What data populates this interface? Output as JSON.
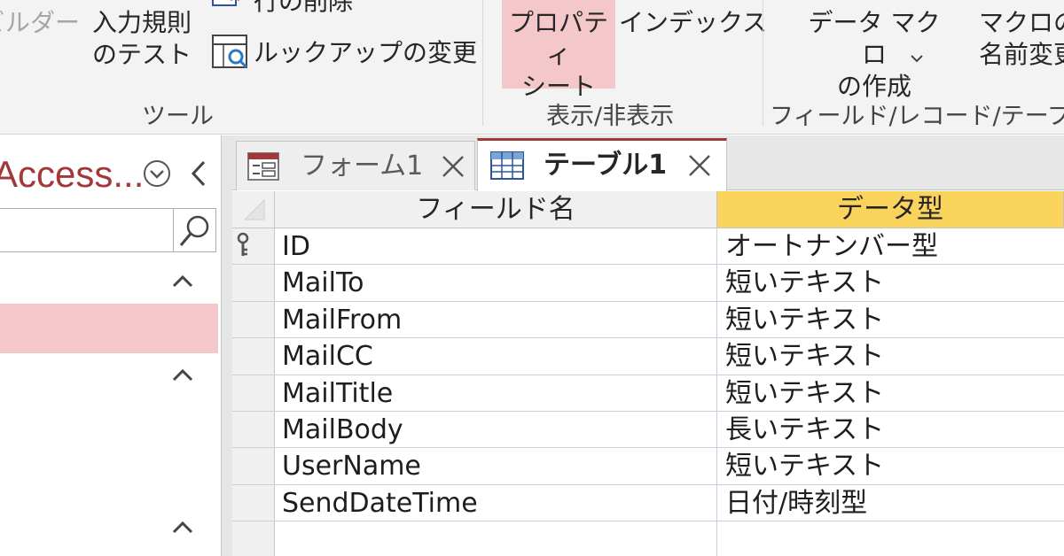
{
  "ribbon": {
    "tools_group": {
      "label": "ツール",
      "builder_label": "ビルダー",
      "test_rules_label": "入力規則\nのテスト",
      "delete_rows_label": "行の削除",
      "modify_lookups_label": "ルックアップの変更"
    },
    "showhide_group": {
      "label": "表示/非表示",
      "property_sheet_label": "プロパティ\nシート",
      "indexes_label": "インデックス"
    },
    "field_record_group": {
      "label": "フィールド/レコード/テーブル",
      "create_macro_label": "データ マクロ\nの作成",
      "rename_macro_label": "マクロの\n名前変更"
    }
  },
  "nav": {
    "title": "Access...",
    "search_placeholder": ""
  },
  "tabs": [
    {
      "label": "フォーム1",
      "icon": "form-icon",
      "active": false
    },
    {
      "label": "テーブル1",
      "icon": "table-icon",
      "active": true
    }
  ],
  "grid": {
    "col_name_header": "フィールド名",
    "col_type_header": "データ型",
    "rows": [
      {
        "name": "ID",
        "type": "オートナンバー型",
        "primary_key": true
      },
      {
        "name": "MailTo",
        "type": "短いテキスト"
      },
      {
        "name": "MailFrom",
        "type": "短いテキスト"
      },
      {
        "name": "MailCC",
        "type": "短いテキスト"
      },
      {
        "name": "MailTitle",
        "type": "短いテキスト"
      },
      {
        "name": "MailBody",
        "type": "長いテキスト"
      },
      {
        "name": "UserName",
        "type": "短いテキスト"
      },
      {
        "name": "SendDateTime",
        "type": "日付/時刻型"
      },
      {
        "name": "",
        "type": ""
      }
    ]
  },
  "colors": {
    "accent": "#a4373a",
    "selected": "#f4c7cb",
    "column_highlight": "#fad35c"
  }
}
